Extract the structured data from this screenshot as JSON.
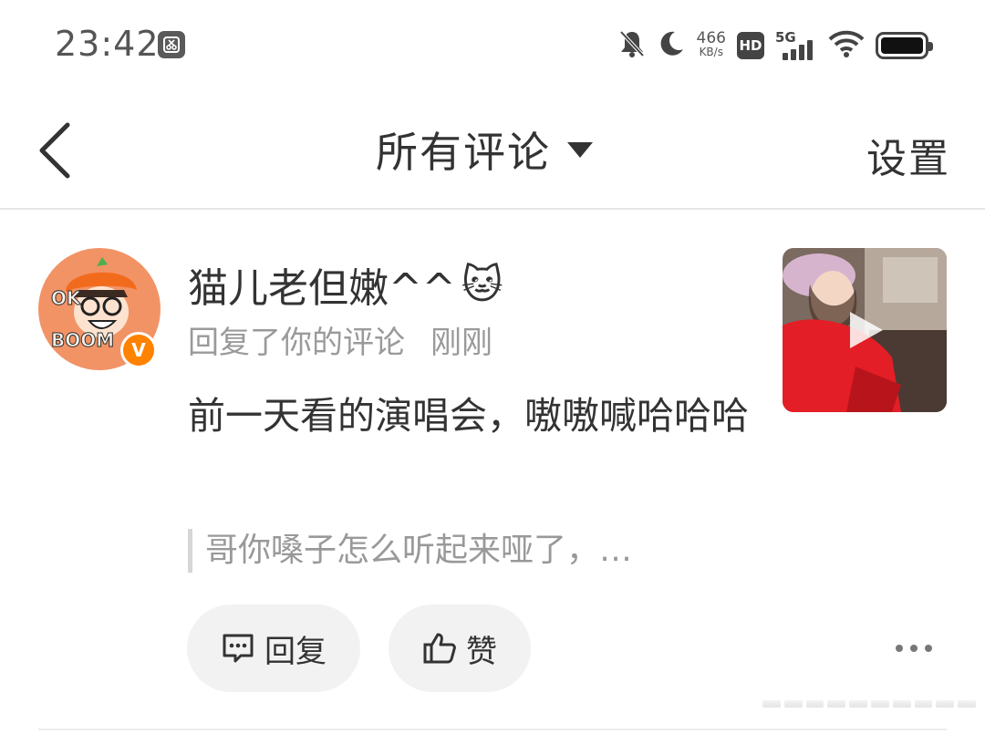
{
  "status_bar": {
    "time": "23:42",
    "network_speed_value": "466",
    "network_speed_unit": "KB/s",
    "hd_label": "HD",
    "signal_label": "5G"
  },
  "nav": {
    "title": "所有评论",
    "settings_label": "设置"
  },
  "notification": {
    "username": "猫儿老但嫩^^",
    "username_emoji": "🐱",
    "verified_label": "V",
    "action_text": "回复了你的评论",
    "time": "刚刚",
    "comment": "前一天看的演唱会，嗷嗷喊哈哈哈",
    "quoted": "哥你嗓子怎么听起来哑了，…",
    "reply_label": "回复",
    "like_label": "赞"
  },
  "colors": {
    "accent": "#ff8200",
    "avatar_bg": "#f29366",
    "text_primary": "#333333",
    "text_secondary": "#9a9a9a"
  },
  "icons": [
    "screenshot-app-icon",
    "mute-bell-icon",
    "moon-icon",
    "wifi-icon",
    "battery-icon",
    "back-chevron-icon",
    "caret-down-icon",
    "comment-bubble-icon",
    "thumbs-up-icon",
    "more-dots-icon",
    "play-icon"
  ]
}
